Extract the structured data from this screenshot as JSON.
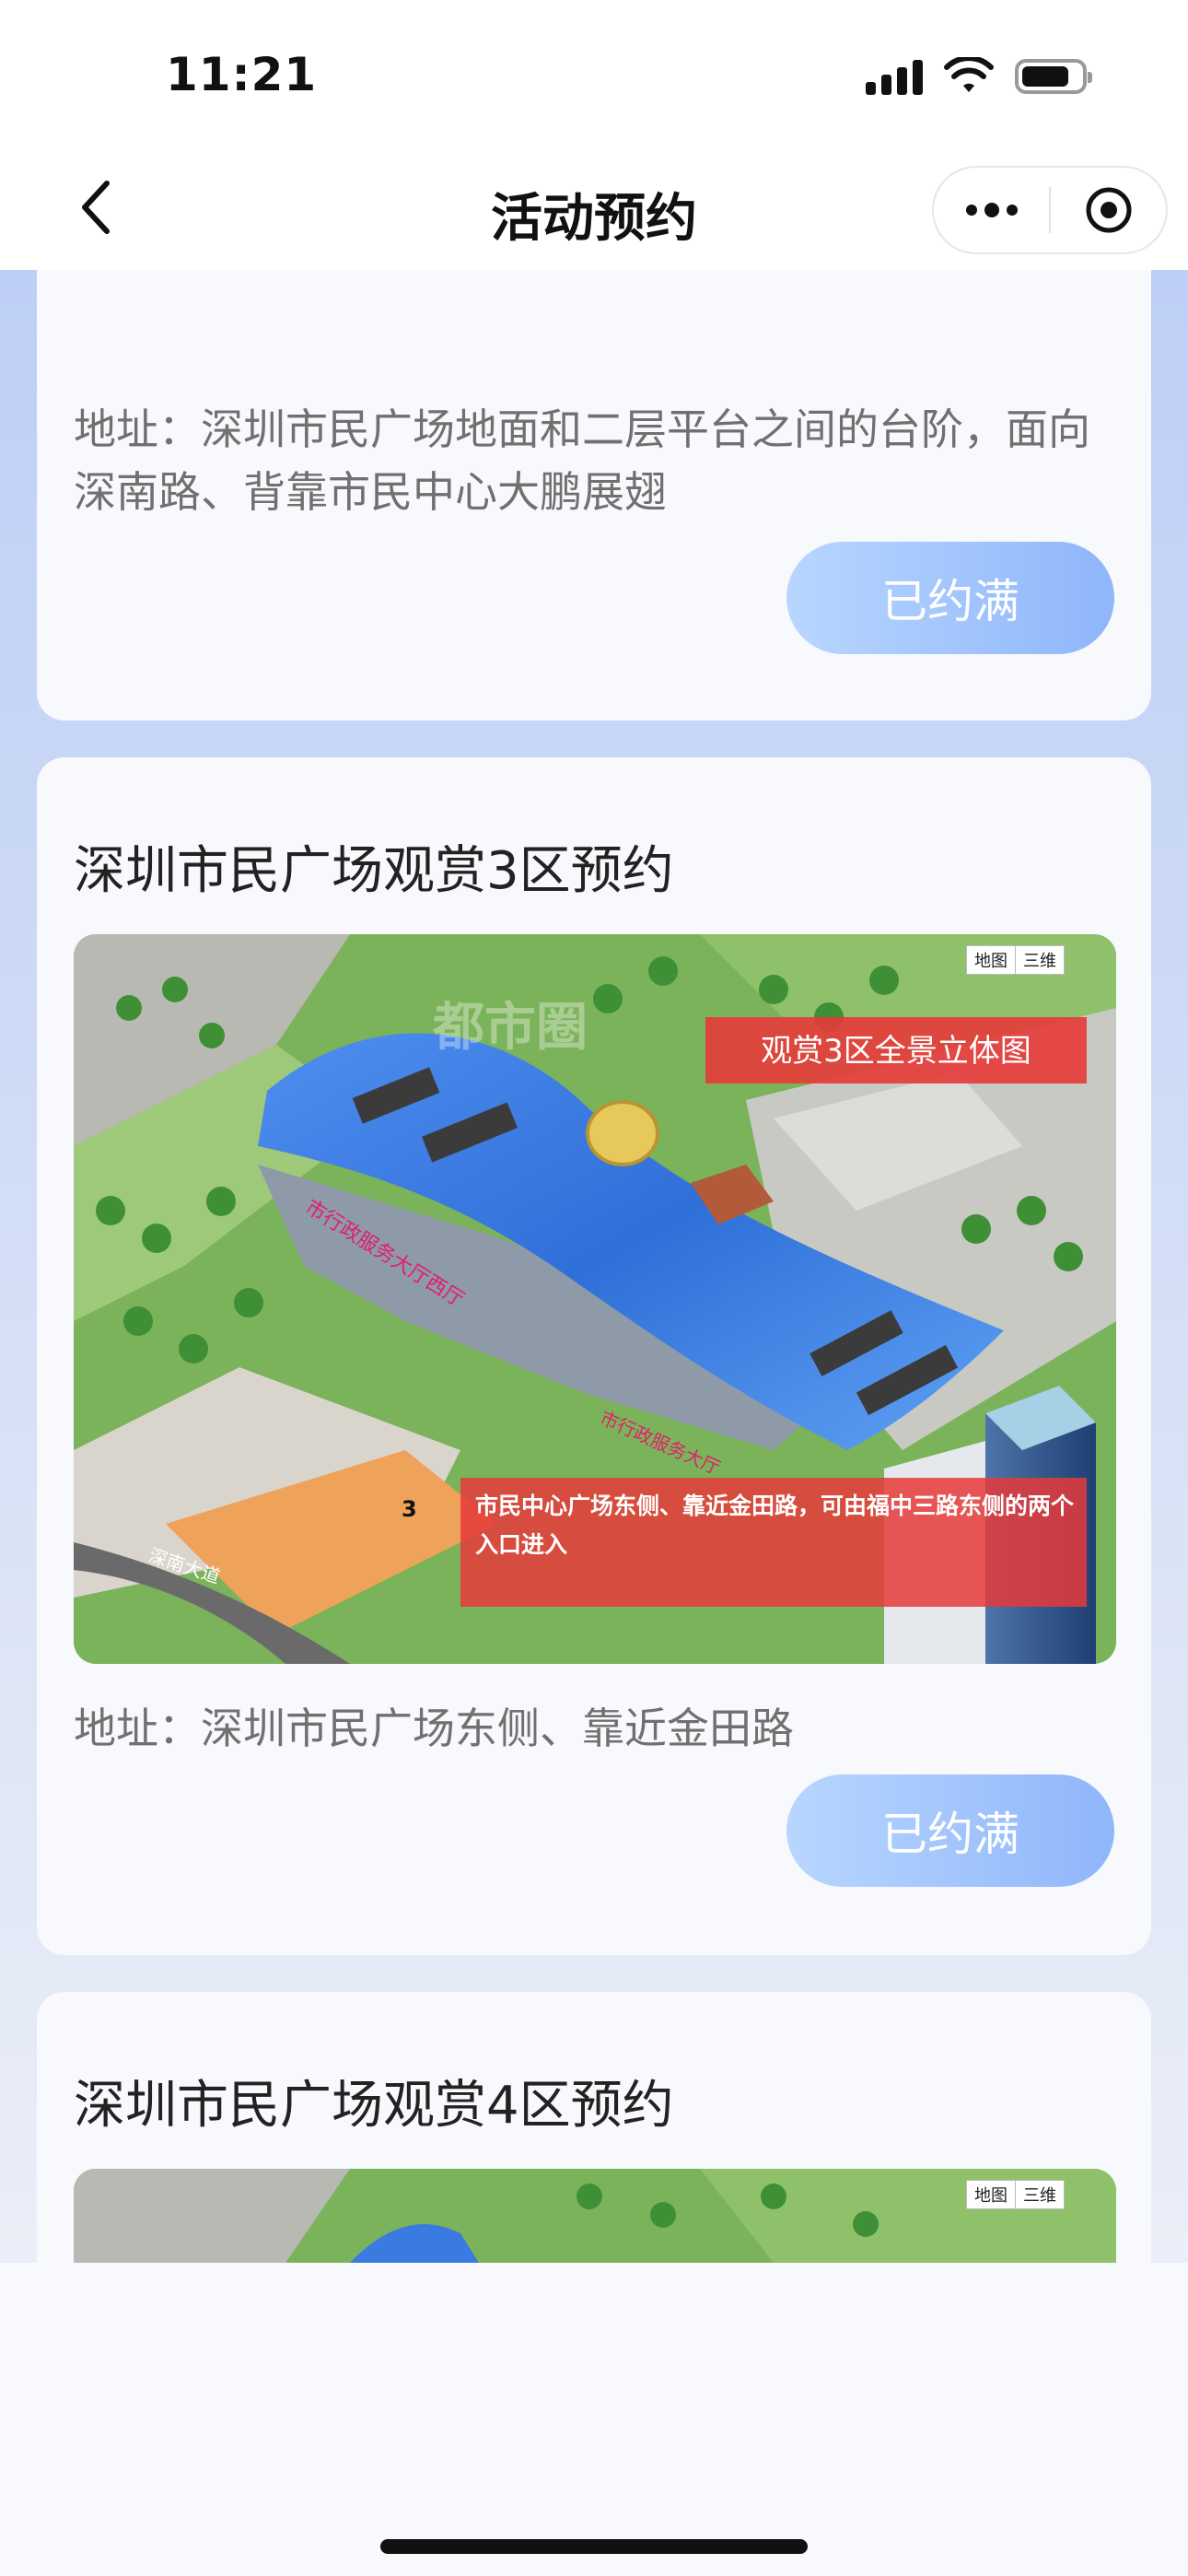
{
  "status_bar": {
    "time": "11:21"
  },
  "nav": {
    "title": "活动预约"
  },
  "cards": [
    {
      "title": "",
      "address": "地址：深圳市民广场地面和二层平台之间的台阶，面向深南路、背靠市民中心大鹏展翅",
      "button_label": "已约满"
    },
    {
      "title": "深圳市民广场观赏3区预约",
      "map": {
        "toggle_map": "地图",
        "toggle_3d": "三维",
        "banner": "观赏3区全景立体图",
        "zone_number": "3",
        "note": "市民中心广场东侧、靠近金田路，可由福中三路东侧的两个入口进入",
        "building_label_1": "市行政服务大厅西厅",
        "building_label_2": "市行政服务大厅",
        "road_label": "深南大道",
        "watermark": "都市圈"
      },
      "address": "地址：深圳市民广场东侧、靠近金田路",
      "button_label": "已约满"
    },
    {
      "title": "深圳市民广场观赏4区预约",
      "map": {
        "toggle_map": "地图",
        "toggle_3d": "三维"
      }
    }
  ],
  "colors": {
    "button_gradient_start": "#b8d6ff",
    "button_gradient_end": "#8fb6fb",
    "roof_blue": "#3b7be0",
    "banner_red": "#e63a3a"
  }
}
